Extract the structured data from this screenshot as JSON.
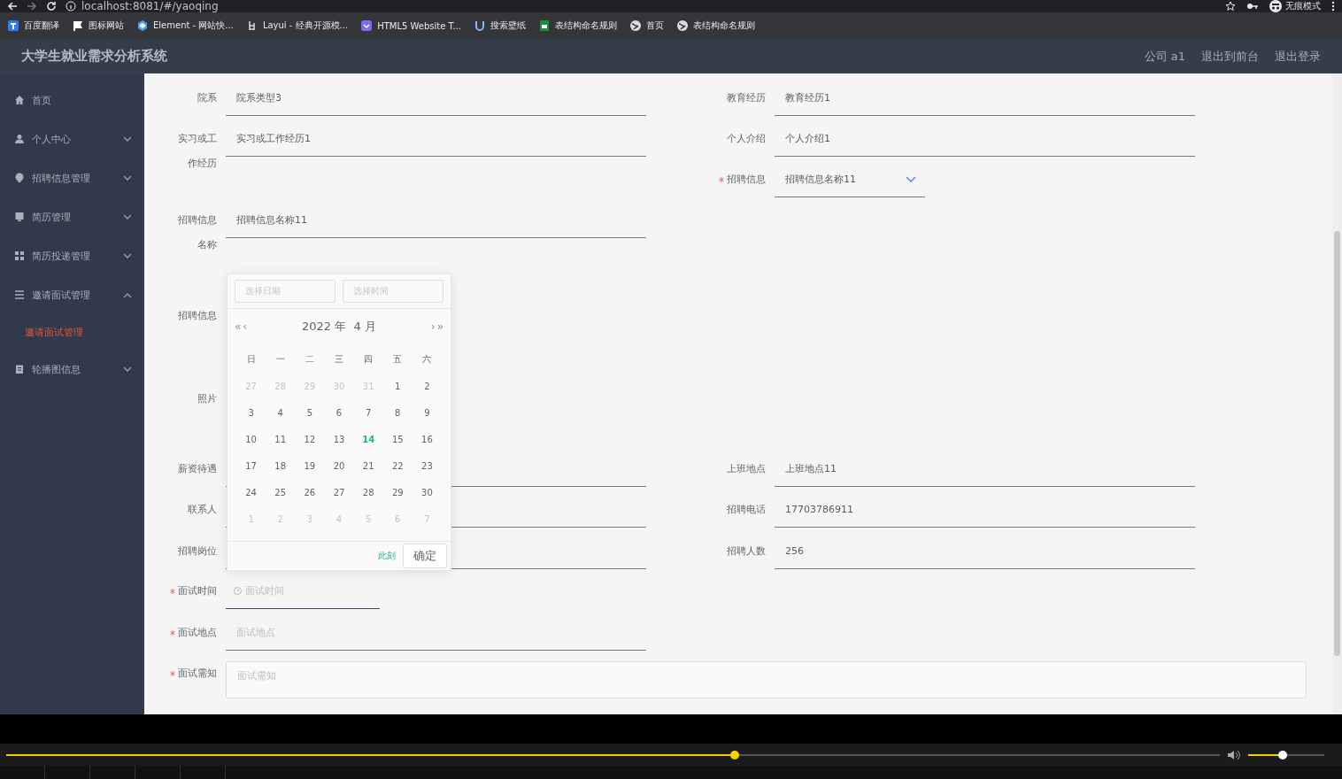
{
  "browser": {
    "address": "localhost:8081/#/yaoqing",
    "profile": "无痕模式",
    "bookmarks": [
      {
        "label": "百度翻译"
      },
      {
        "label": "图标网站"
      },
      {
        "label": "Element - 网站快..."
      },
      {
        "label": "Layui - 经典开源模..."
      },
      {
        "label": "HTML5 Website T..."
      },
      {
        "label": "搜索壁纸"
      },
      {
        "label": "表结构命名规则"
      },
      {
        "label": "首页"
      },
      {
        "label": "表结构命名规则"
      }
    ]
  },
  "header": {
    "title": "大学生就业需求分析系统",
    "links": [
      "公司 a1",
      "退出到前台",
      "退出登录"
    ]
  },
  "sidebar": {
    "items": [
      {
        "label": "首页",
        "kind": "link"
      },
      {
        "label": "个人中心",
        "kind": "menu",
        "expanded": false
      },
      {
        "label": "招聘信息管理",
        "kind": "menu",
        "expanded": false
      },
      {
        "label": "简历管理",
        "kind": "menu",
        "expanded": false
      },
      {
        "label": "简历投递管理",
        "kind": "menu",
        "expanded": false
      },
      {
        "label": "邀请面试管理",
        "kind": "menu",
        "expanded": true,
        "children": [
          {
            "label": "邀请面试管理",
            "selected": true
          }
        ]
      },
      {
        "label": "轮播图信息",
        "kind": "menu",
        "expanded": false
      }
    ]
  },
  "form": {
    "left": [
      {
        "label": "院系",
        "kind": "text",
        "value": "院系类型3",
        "required": false
      },
      {
        "label": "实习或工作经历",
        "kind": "text",
        "value": "实习或工作经历1",
        "required": false
      },
      {
        "label": "招聘信息名称",
        "kind": "text",
        "value": "招聘信息名称11",
        "required": false
      },
      {
        "label": "招聘信息",
        "kind": "blank",
        "required": false
      },
      {
        "label": "照片",
        "kind": "blank",
        "required": false
      },
      {
        "label": "薪资待遇",
        "kind": "text",
        "required": false
      },
      {
        "label": "联系人",
        "kind": "text",
        "required": false
      },
      {
        "label": "招聘岗位",
        "kind": "text",
        "required": false
      },
      {
        "label": "面试时间",
        "kind": "datetime",
        "placeholder": "面试时间",
        "required": true
      },
      {
        "label": "面试地点",
        "kind": "text",
        "placeholder": "面试地点",
        "required": true
      }
    ],
    "right": [
      {
        "label": "教育经历",
        "kind": "text",
        "value": "教育经历1",
        "required": false
      },
      {
        "label": "个人介绍",
        "kind": "text",
        "value": "个人介绍1",
        "required": false
      },
      {
        "label": "招聘信息",
        "kind": "select",
        "value": "招聘信息名称11",
        "required": true
      },
      {
        "label": "上班地点",
        "kind": "text",
        "value": "上班地点11",
        "required": false
      },
      {
        "label": "招聘电话",
        "kind": "text",
        "value": "17703786911",
        "required": false
      },
      {
        "label": "招聘人数",
        "kind": "text",
        "value": "256",
        "required": false
      }
    ],
    "notes": {
      "label": "面试需知",
      "placeholder": "面试需知",
      "required": true
    }
  },
  "date_picker": {
    "date_placeholder": "选择日期",
    "time_placeholder": "选择时间",
    "prev_year": "«",
    "prev_month": "‹",
    "title": "2022 年  4 月",
    "next_month": "›",
    "next_year": "»",
    "weekdays": [
      "日",
      "一",
      "二",
      "三",
      "四",
      "五",
      "六"
    ],
    "days": [
      {
        "label": "27",
        "kind": "other",
        "today": false
      },
      {
        "label": "28",
        "kind": "other",
        "today": false
      },
      {
        "label": "29",
        "kind": "other",
        "today": false
      },
      {
        "label": "30",
        "kind": "other",
        "today": false
      },
      {
        "label": "31",
        "kind": "other",
        "today": false
      },
      {
        "label": "1",
        "kind": "current",
        "today": false
      },
      {
        "label": "2",
        "kind": "current",
        "today": false
      },
      {
        "label": "3",
        "kind": "current",
        "today": false
      },
      {
        "label": "4",
        "kind": "current",
        "today": false
      },
      {
        "label": "5",
        "kind": "current",
        "today": false
      },
      {
        "label": "6",
        "kind": "current",
        "today": false
      },
      {
        "label": "7",
        "kind": "current",
        "today": false
      },
      {
        "label": "8",
        "kind": "current",
        "today": false
      },
      {
        "label": "9",
        "kind": "current",
        "today": false
      },
      {
        "label": "10",
        "kind": "current",
        "today": false
      },
      {
        "label": "11",
        "kind": "current",
        "today": false
      },
      {
        "label": "12",
        "kind": "current",
        "today": false
      },
      {
        "label": "13",
        "kind": "current",
        "today": false
      },
      {
        "label": "14",
        "kind": "current",
        "today": true
      },
      {
        "label": "15",
        "kind": "current",
        "today": false
      },
      {
        "label": "16",
        "kind": "current",
        "today": false
      },
      {
        "label": "17",
        "kind": "current",
        "today": false
      },
      {
        "label": "18",
        "kind": "current",
        "today": false
      },
      {
        "label": "19",
        "kind": "current",
        "today": false
      },
      {
        "label": "20",
        "kind": "current",
        "today": false
      },
      {
        "label": "21",
        "kind": "current",
        "today": false
      },
      {
        "label": "22",
        "kind": "current",
        "today": false
      },
      {
        "label": "23",
        "kind": "current",
        "today": false
      },
      {
        "label": "24",
        "kind": "current",
        "today": false
      },
      {
        "label": "25",
        "kind": "current",
        "today": false
      },
      {
        "label": "26",
        "kind": "current",
        "today": false
      },
      {
        "label": "27",
        "kind": "current",
        "today": false
      },
      {
        "label": "28",
        "kind": "current",
        "today": false
      },
      {
        "label": "29",
        "kind": "current",
        "today": false
      },
      {
        "label": "30",
        "kind": "current",
        "today": false
      },
      {
        "label": "1",
        "kind": "other",
        "today": false
      },
      {
        "label": "2",
        "kind": "other",
        "today": false
      },
      {
        "label": "3",
        "kind": "other",
        "today": false
      },
      {
        "label": "4",
        "kind": "other",
        "today": false
      },
      {
        "label": "5",
        "kind": "other",
        "today": false
      },
      {
        "label": "6",
        "kind": "other",
        "today": false
      },
      {
        "label": "7",
        "kind": "other",
        "today": false
      }
    ],
    "now_button": "此刻",
    "confirm_button": "确定"
  },
  "player": {
    "progress": {
      "level": 0.6
    },
    "volume": {
      "level": 0.45
    }
  }
}
